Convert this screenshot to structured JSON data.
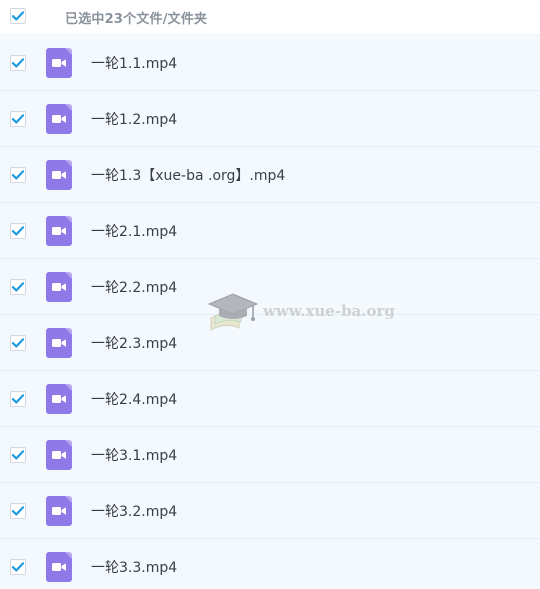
{
  "header": {
    "select_all_checked": true,
    "title": "已选中23个文件/文件夹"
  },
  "files": [
    {
      "name": "一轮1.1.mp4",
      "checked": true,
      "icon": "video-file-icon"
    },
    {
      "name": "一轮1.2.mp4",
      "checked": true,
      "icon": "video-file-icon"
    },
    {
      "name": "一轮1.3【xue-ba .org】.mp4",
      "checked": true,
      "icon": "video-file-icon"
    },
    {
      "name": "一轮2.1.mp4",
      "checked": true,
      "icon": "video-file-icon"
    },
    {
      "name": "一轮2.2.mp4",
      "checked": true,
      "icon": "video-file-icon"
    },
    {
      "name": "一轮2.3.mp4",
      "checked": true,
      "icon": "video-file-icon"
    },
    {
      "name": "一轮2.4.mp4",
      "checked": true,
      "icon": "video-file-icon"
    },
    {
      "name": "一轮3.1.mp4",
      "checked": true,
      "icon": "video-file-icon"
    },
    {
      "name": "一轮3.2.mp4",
      "checked": true,
      "icon": "video-file-icon"
    },
    {
      "name": "一轮3.3.mp4",
      "checked": true,
      "icon": "video-file-icon"
    }
  ],
  "watermark": {
    "text": "www.xue-ba.org"
  },
  "colors": {
    "check": "#1e9be0",
    "row_bg": "#f3f9fd",
    "row_border": "#dfeff8",
    "video_icon": "#8f79e8",
    "header_text": "#8a929c"
  }
}
